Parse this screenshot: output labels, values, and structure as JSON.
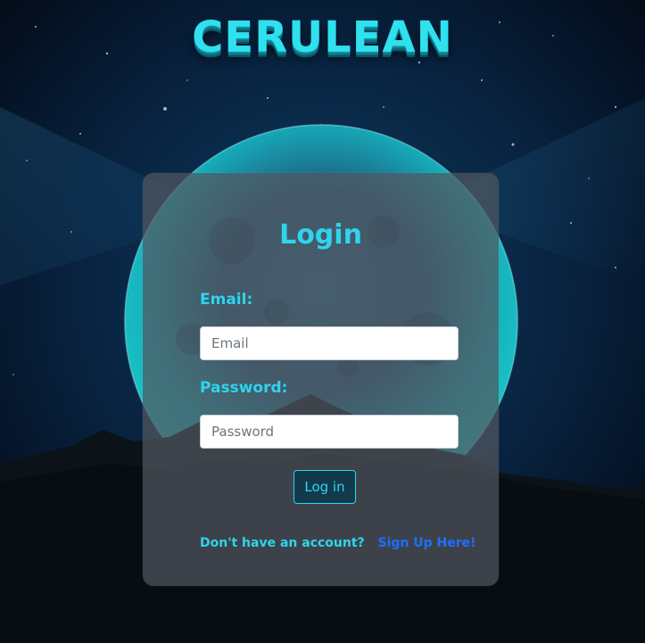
{
  "brand": {
    "title": "CERULEAN"
  },
  "login": {
    "title": "Login",
    "email_label": "Email:",
    "email_placeholder": "Email",
    "email_value": "",
    "password_label": "Password:",
    "password_placeholder": "Password",
    "password_value": "",
    "submit_label": "Log in",
    "signup_prompt": "Don't have an account?",
    "signup_link": "Sign Up Here!"
  },
  "colors": {
    "accent": "#2fd4ee",
    "link": "#1f6fff",
    "card_bg": "#525860",
    "page_bg": "#050a16"
  },
  "background": {
    "description_icon": "moon-over-mountains-night-sky"
  }
}
